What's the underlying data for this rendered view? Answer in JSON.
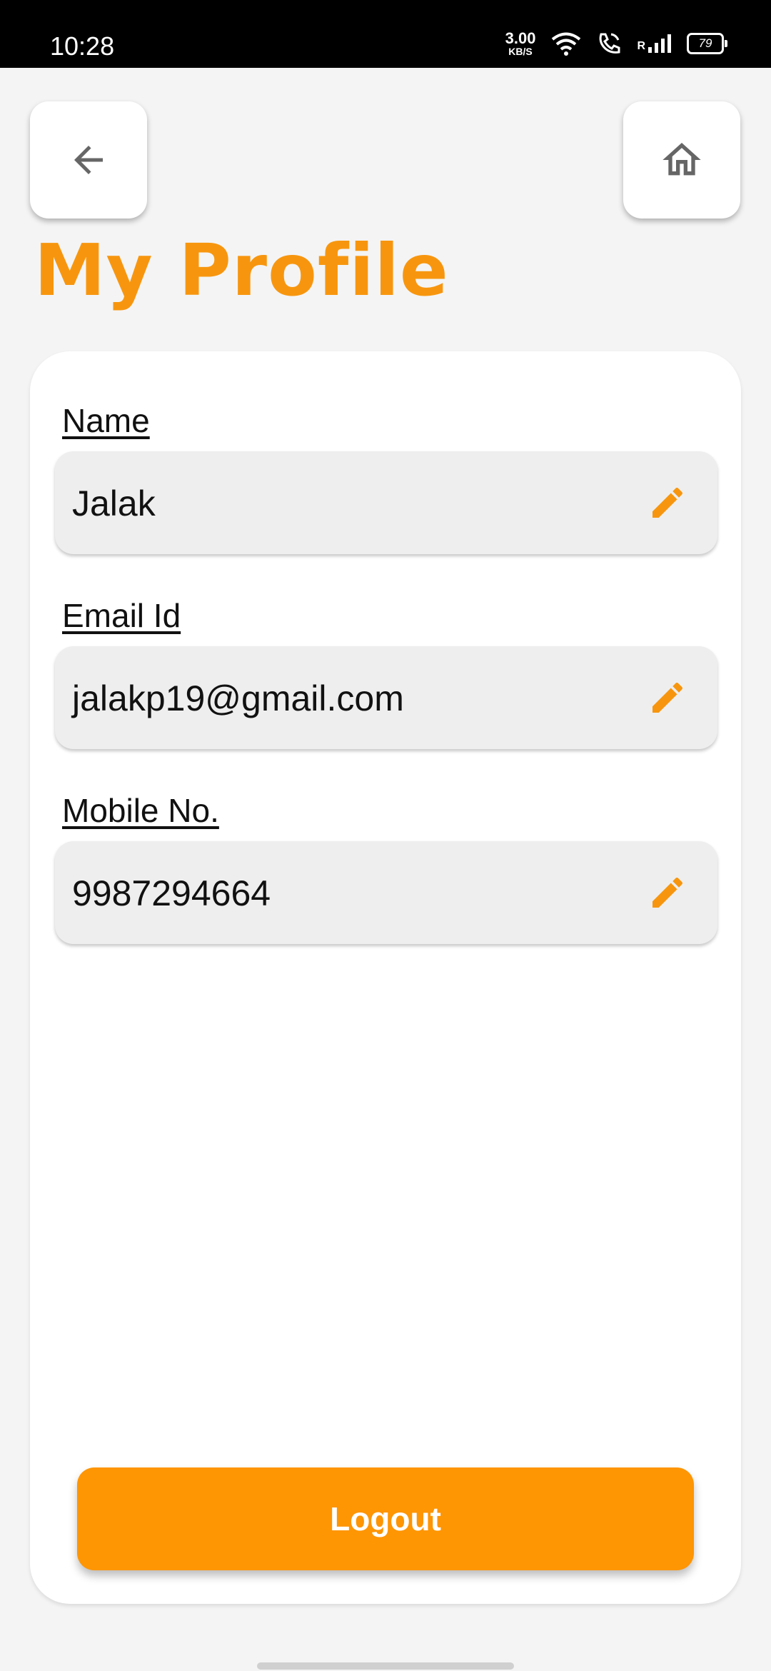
{
  "status_bar": {
    "time": "10:28",
    "net_speed_value": "3.00",
    "net_speed_unit": "KB/S",
    "roaming": "R",
    "battery": "79"
  },
  "header": {
    "title": "My Profile"
  },
  "profile": {
    "name_label": "Name",
    "name_value": "Jalak",
    "email_label": "Email Id",
    "email_value": "jalakp19@gmail.com",
    "mobile_label": "Mobile No.",
    "mobile_value": "9987294664"
  },
  "logout_label": "Logout",
  "colors": {
    "accent": "#f7960e",
    "button": "#fe9503"
  },
  "icons": [
    "back-arrow-icon",
    "home-icon",
    "edit-pencil-icon",
    "wifi-icon",
    "wifi-calling-icon",
    "signal-icon",
    "battery-icon"
  ]
}
